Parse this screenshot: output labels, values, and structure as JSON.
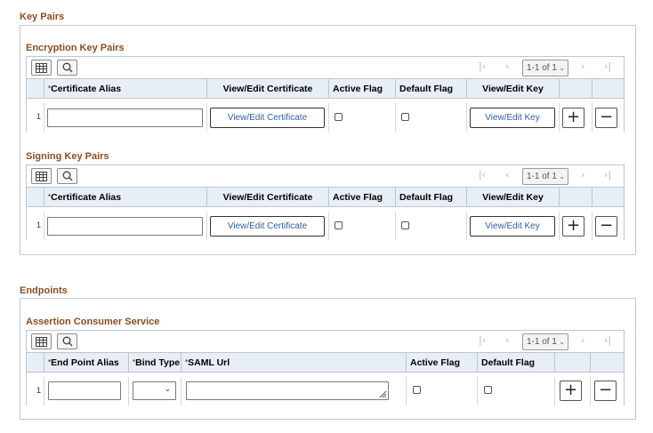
{
  "key_pairs": {
    "title": "Key Pairs",
    "encryption": {
      "title": "Encryption Key Pairs",
      "pager": "1-1 of 1",
      "headers": [
        "Certificate Alias",
        "View/Edit Certificate",
        "Active Flag",
        "Default Flag",
        "View/Edit Key"
      ],
      "row_number": "1",
      "certificate_alias": "",
      "view_cert_label": "View/Edit Certificate",
      "view_key_label": "View/Edit Key",
      "active_flag": false,
      "default_flag": false
    },
    "signing": {
      "title": "Signing Key Pairs",
      "pager": "1-1 of 1",
      "headers": [
        "Certificate Alias",
        "View/Edit Certificate",
        "Active Flag",
        "Default Flag",
        "View/Edit Key"
      ],
      "row_number": "1",
      "certificate_alias": "",
      "view_cert_label": "View/Edit Certificate",
      "view_key_label": "View/Edit Key",
      "active_flag": false,
      "default_flag": false
    }
  },
  "endpoints": {
    "title": "Endpoints",
    "acs": {
      "title": "Assertion Consumer Service",
      "pager": "1-1 of 1",
      "headers": [
        "End Point Alias",
        "Bind Type",
        "SAML Url",
        "Active Flag",
        "Default Flag"
      ],
      "row_number": "1",
      "end_point_alias": "",
      "bind_type": "",
      "saml_url": "",
      "active_flag": false,
      "default_flag": false
    }
  },
  "buttons": {
    "add": "+",
    "remove": "−"
  },
  "icons": {
    "grid": "grid-personalize-icon",
    "search": "search-icon",
    "first": "first-page-icon",
    "prev": "previous-page-icon",
    "next": "next-page-icon",
    "last": "last-page-icon"
  },
  "colors": {
    "section_title": "#8d4d22",
    "header_bg": "#e8eef6",
    "link": "#2f5fa3"
  }
}
